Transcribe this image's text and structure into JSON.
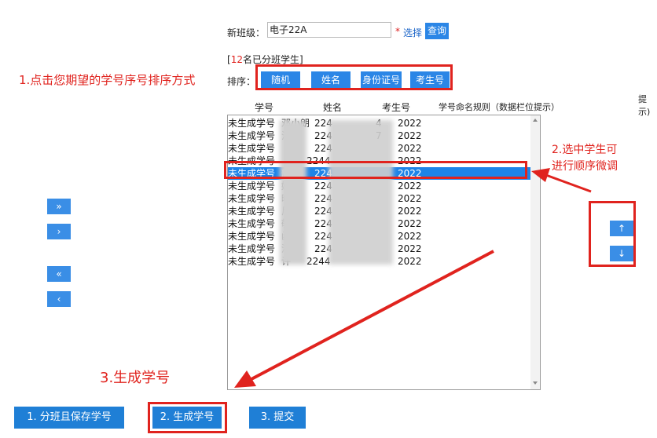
{
  "form": {
    "new_class_label": "新班级：",
    "new_class_value": "电子22A",
    "required_mark": "*",
    "select_link": "选择",
    "query_button": "查询",
    "count_prefix": "[",
    "count_number": "12",
    "count_suffix": "名已分班学生]",
    "sort_label": "排序：",
    "sort_buttons": [
      "随机",
      "姓名",
      "身份证号",
      "考生号"
    ]
  },
  "table": {
    "headers": [
      "学号",
      "姓名",
      "考生号",
      "学号命名规则（数据栏位提示）"
    ],
    "right_hint": "提示)",
    "rows": [
      {
        "status": "未生成学号",
        "name": "邓小朗",
        "id": "224",
        "tail": "4",
        "year": "2022"
      },
      {
        "status": "未生成学号",
        "name": "洪博",
        "id": "224",
        "tail": "7",
        "year": "2022"
      },
      {
        "status": "未生成学号",
        "name": "",
        "id": "224",
        "tail": "",
        "year": "2022"
      },
      {
        "status": "未生成学号",
        "name": "",
        "id": "2244",
        "tail": "",
        "year": "2022"
      },
      {
        "status": "未生成学号",
        "name": "辉",
        "id": "224",
        "tail": "",
        "year": "2022"
      },
      {
        "status": "未生成学号",
        "name": "媛",
        "id": "224",
        "tail": "",
        "year": "2022"
      },
      {
        "status": "未生成学号",
        "name": "曦",
        "id": "224",
        "tail": "",
        "year": "2022"
      },
      {
        "status": "未生成学号",
        "name": "尼",
        "id": "224",
        "tail": "",
        "year": "2022"
      },
      {
        "status": "未生成学号",
        "name": "敬",
        "id": "224",
        "tail": "",
        "year": "2022"
      },
      {
        "status": "未生成学号",
        "name": "函",
        "id": "224",
        "tail": "",
        "year": "2022"
      },
      {
        "status": "未生成学号",
        "name": "浣",
        "id": "224",
        "tail": "",
        "year": "2022"
      },
      {
        "status": "未生成学号",
        "name": "许",
        "id": "2244",
        "tail": "",
        "year": "2022"
      }
    ],
    "selected_index": 4
  },
  "move_buttons": {
    "all_right": "»",
    "right": "›",
    "all_left": "«",
    "left": "‹"
  },
  "order_buttons": {
    "up": "↑",
    "down": "↓"
  },
  "actions": {
    "save": "1. 分班且保存学号",
    "generate": "2. 生成学号",
    "submit": "3. 提交"
  },
  "annotations": {
    "step1": "1.点击您期望的学号序号排序方式",
    "step2_line1": "2.选中学生可",
    "step2_line2": "进行顺序微调",
    "step3": "3.生成学号"
  },
  "colors": {
    "accent": "#2b86e6",
    "annotation": "#e0231e",
    "selected_row": "#1e84e8"
  }
}
